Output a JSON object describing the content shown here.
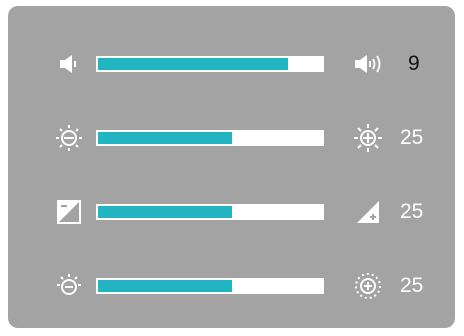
{
  "colors": {
    "panel": "#a3a3a3",
    "track": "#ffffff",
    "fill": "#22b4c0",
    "icon": "#ffffff",
    "value_dark": "#111111",
    "value_light": "#ffffff"
  },
  "sliders": [
    {
      "id": "volume",
      "left_icon": "speaker-low-icon",
      "right_icon": "speaker-high-icon",
      "value": "9",
      "level": 0.85
    },
    {
      "id": "brightness",
      "left_icon": "brightness-low-icon",
      "right_icon": "brightness-high-icon",
      "value": "25",
      "level": 0.6
    },
    {
      "id": "contrast",
      "left_icon": "contrast-low-icon",
      "right_icon": "contrast-high-icon",
      "value": "25",
      "level": 0.6
    },
    {
      "id": "backlight",
      "left_icon": "backlight-low-icon",
      "right_icon": "backlight-high-icon",
      "value": "25",
      "level": 0.6
    }
  ]
}
